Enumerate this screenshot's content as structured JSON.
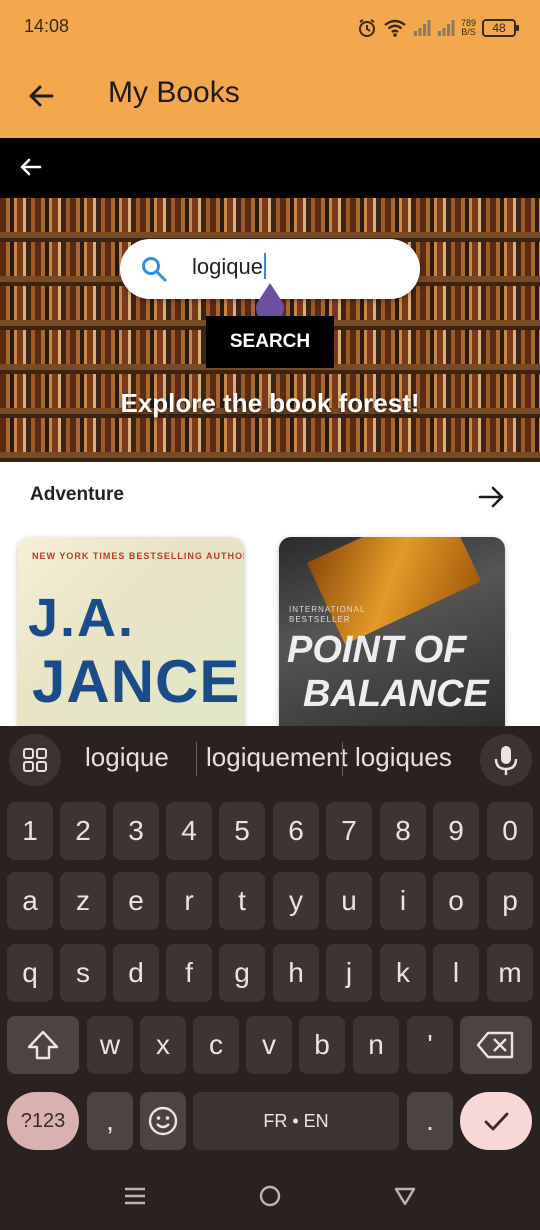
{
  "status_bar": {
    "time": "14:08",
    "net_speed_top": "789",
    "net_speed_bottom": "B/S",
    "battery": "48"
  },
  "app_bar": {
    "title": "My Books"
  },
  "search": {
    "value": "logique",
    "button_label": "SEARCH"
  },
  "hero": {
    "tagline": "Explore the book forest!"
  },
  "category": {
    "title": "Adventure",
    "books": [
      {
        "tag": "NEW YORK TIMES BESTSELLING AUTHOR",
        "line1": "J.A.",
        "line2": "JANCE"
      },
      {
        "tag_line1": "INTERNATIONAL",
        "tag_line2": "BESTSELLER",
        "line1": "POINT OF",
        "line2": "BALANCE"
      }
    ]
  },
  "keyboard": {
    "suggestions": [
      "logique",
      "logiquement",
      "logiques"
    ],
    "row_numbers": [
      "1",
      "2",
      "3",
      "4",
      "5",
      "6",
      "7",
      "8",
      "9",
      "0"
    ],
    "row1": [
      "a",
      "z",
      "e",
      "r",
      "t",
      "y",
      "u",
      "i",
      "o",
      "p"
    ],
    "row2": [
      "q",
      "s",
      "d",
      "f",
      "g",
      "h",
      "j",
      "k",
      "l",
      "m"
    ],
    "row3": [
      "w",
      "x",
      "c",
      "v",
      "b",
      "n",
      "'"
    ],
    "sym_label": "?123",
    "comma": ",",
    "space_label": "FR • EN",
    "period": "."
  },
  "colors": {
    "app_bar": "#f3a84e",
    "accent": "#2e8fe0",
    "keyboard_bg": "#2a2220",
    "handle": "#6b4fa0"
  }
}
